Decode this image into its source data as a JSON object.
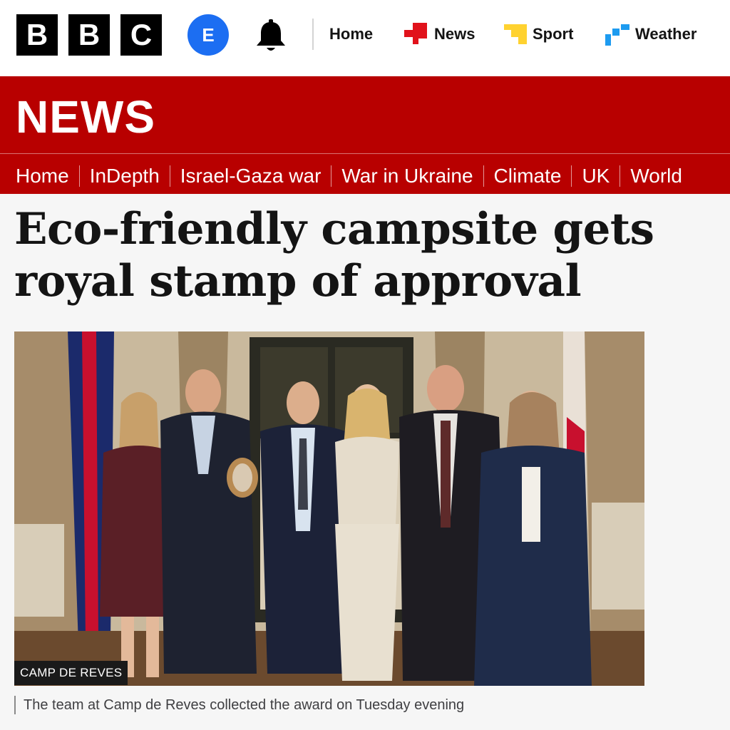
{
  "brand": {
    "logo_letters": [
      "B",
      "B",
      "C"
    ]
  },
  "account": {
    "initial": "E"
  },
  "icons": {
    "notifications": "bell-icon"
  },
  "top_nav": [
    {
      "label": "Home",
      "icon": ""
    },
    {
      "label": "News",
      "icon": "news-icon"
    },
    {
      "label": "Sport",
      "icon": "sport-icon"
    },
    {
      "label": "Weather",
      "icon": "weather-icon"
    }
  ],
  "masthead": {
    "title": "NEWS",
    "color": "#b80000"
  },
  "sub_nav": [
    "Home",
    "InDepth",
    "Israel-Gaza war",
    "War in Ukraine",
    "Climate",
    "UK",
    "World"
  ],
  "article": {
    "headline_line1": "Eco-friendly campsite gets",
    "headline_line2": "royal stamp of approval",
    "image_credit": "CAMP DE REVES",
    "caption": "The team at Camp de Reves collected the award on Tuesday evening"
  },
  "colors": {
    "account_blue": "#1c6ef2",
    "news_red": "#e1121b",
    "sport_yellow": "#ffd230",
    "weather_blue": "#1d9bf0"
  }
}
